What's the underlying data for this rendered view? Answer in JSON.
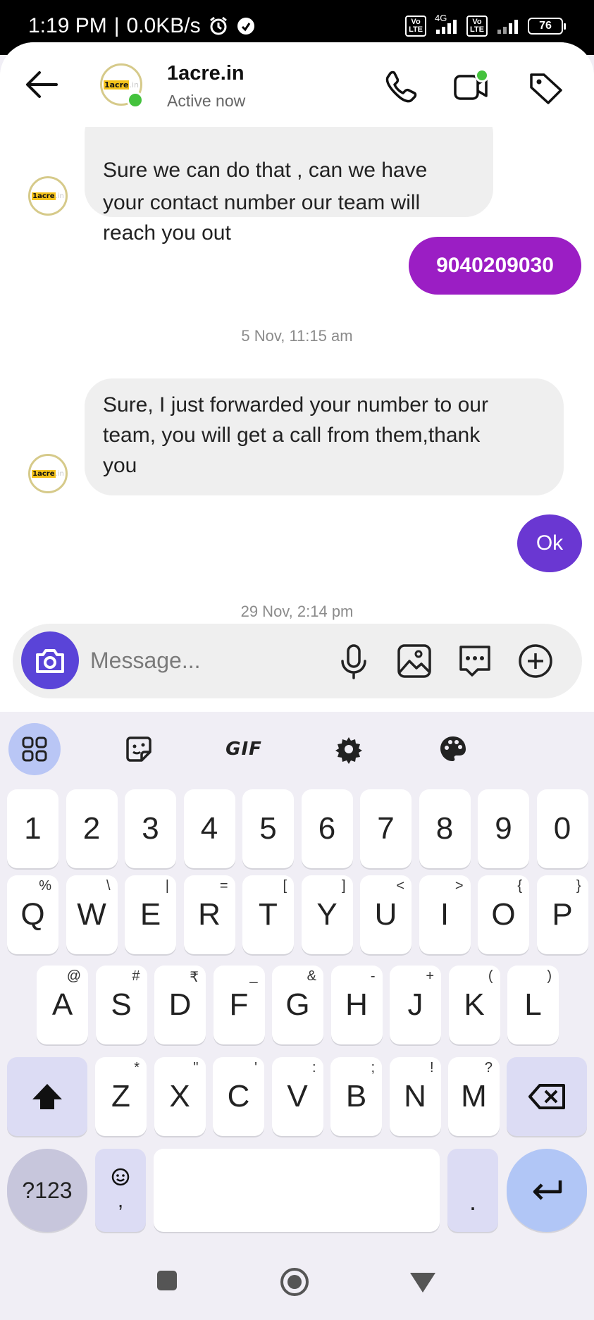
{
  "status_bar": {
    "time": "1:19 PM",
    "speed": "0.0KB/s",
    "network": "4G",
    "volte_label": "Vo LTE",
    "battery": "76"
  },
  "header": {
    "contact_name": "1acre.in",
    "contact_status": "Active now",
    "avatar_text": "1acre.in"
  },
  "messages": [
    {
      "type": "incoming",
      "lines": [
        "Sure we can do that , can we have",
        "your contact number our team will",
        "reach you out"
      ]
    },
    {
      "type": "outgoing",
      "text": "9040209030"
    },
    {
      "type": "timestamp",
      "text": "5 Nov, 11:15 am"
    },
    {
      "type": "incoming",
      "lines": [
        "Sure, I just forwarded your number to our",
        "team, you will get a call from them,thank",
        "you"
      ]
    },
    {
      "type": "outgoing",
      "text": "Ok"
    },
    {
      "type": "timestamp",
      "text": "29 Nov, 2:14 pm"
    }
  ],
  "composer": {
    "placeholder": "Message..."
  },
  "keyboard": {
    "toolbar": {
      "gif_label": "GIF"
    },
    "number_row": [
      "1",
      "2",
      "3",
      "4",
      "5",
      "6",
      "7",
      "8",
      "9",
      "0"
    ],
    "row1": [
      {
        "key": "Q",
        "alt": "%"
      },
      {
        "key": "W",
        "alt": "\\"
      },
      {
        "key": "E",
        "alt": "|"
      },
      {
        "key": "R",
        "alt": "="
      },
      {
        "key": "T",
        "alt": "["
      },
      {
        "key": "Y",
        "alt": "]"
      },
      {
        "key": "U",
        "alt": "<"
      },
      {
        "key": "I",
        "alt": ">"
      },
      {
        "key": "O",
        "alt": "{"
      },
      {
        "key": "P",
        "alt": "}"
      }
    ],
    "row2": [
      {
        "key": "A",
        "alt": "@"
      },
      {
        "key": "S",
        "alt": "#"
      },
      {
        "key": "D",
        "alt": "₹"
      },
      {
        "key": "F",
        "alt": "_"
      },
      {
        "key": "G",
        "alt": "&"
      },
      {
        "key": "H",
        "alt": "-"
      },
      {
        "key": "J",
        "alt": "+"
      },
      {
        "key": "K",
        "alt": "("
      },
      {
        "key": "L",
        "alt": ")"
      }
    ],
    "row3": [
      {
        "key": "Z",
        "alt": "*"
      },
      {
        "key": "X",
        "alt": "\""
      },
      {
        "key": "C",
        "alt": "'"
      },
      {
        "key": "V",
        "alt": ":"
      },
      {
        "key": "B",
        "alt": ";"
      },
      {
        "key": "N",
        "alt": "!"
      },
      {
        "key": "M",
        "alt": "?"
      }
    ],
    "sym_label": "?123",
    "comma_label": ",",
    "period_label": "."
  },
  "colors": {
    "outgoing_number_bubble": "#9b1ec4",
    "outgoing_ok_bubble": "#6a37d2",
    "camera_button": "#5a44d8",
    "online_dot": "#44c23d"
  }
}
